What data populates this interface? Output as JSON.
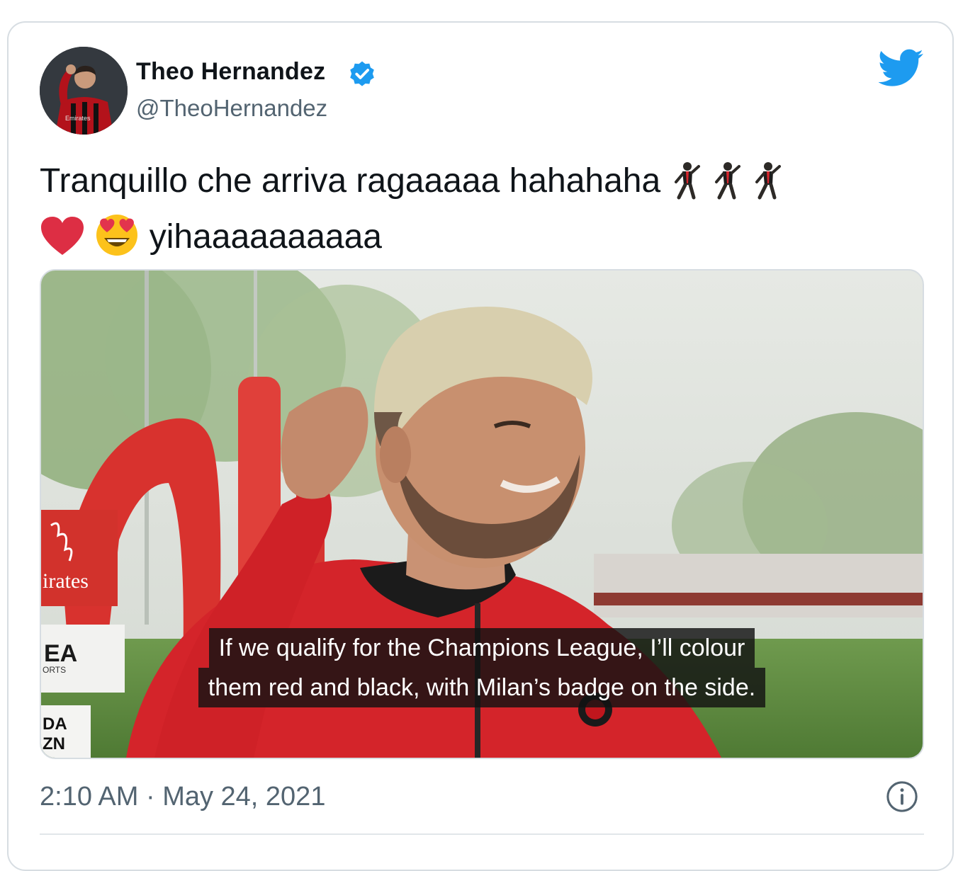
{
  "author": {
    "display_name": "Theo Hernandez",
    "handle": "@TheoHernandez",
    "verified": true,
    "avatar_icon": "profile-photo"
  },
  "brand_icon": "twitter-bird-icon",
  "colors": {
    "twitter_blue": "#1d9bf0",
    "text_primary": "#0f1419",
    "text_secondary": "#536471",
    "border": "#d7dde2"
  },
  "tweet": {
    "line1_text": "Tranquillo che arriva ragaaaaa hahahaha",
    "line1_emojis": [
      "dancing-man-emoji",
      "dancing-man-emoji",
      "dancing-man-emoji"
    ],
    "line2_emojis": [
      "red-heart-emoji",
      "heart-eyes-emoji"
    ],
    "line2_text": "yihaaaaaaaaaa"
  },
  "media": {
    "type": "video-still",
    "sponsor_board_text": "irates",
    "ea_board_text": "EA",
    "ea_board_subtext": "ORTS",
    "dazn_text_top": "DA",
    "dazn_text_bottom": "ZN",
    "subtitle_line1": "If we qualify for the Champions League, I’ll colour",
    "subtitle_line2": "them red and black, with Milan’s badge on the side."
  },
  "footer": {
    "timestamp": "2:10 AM · May 24, 2021",
    "info_icon": "info-icon"
  }
}
